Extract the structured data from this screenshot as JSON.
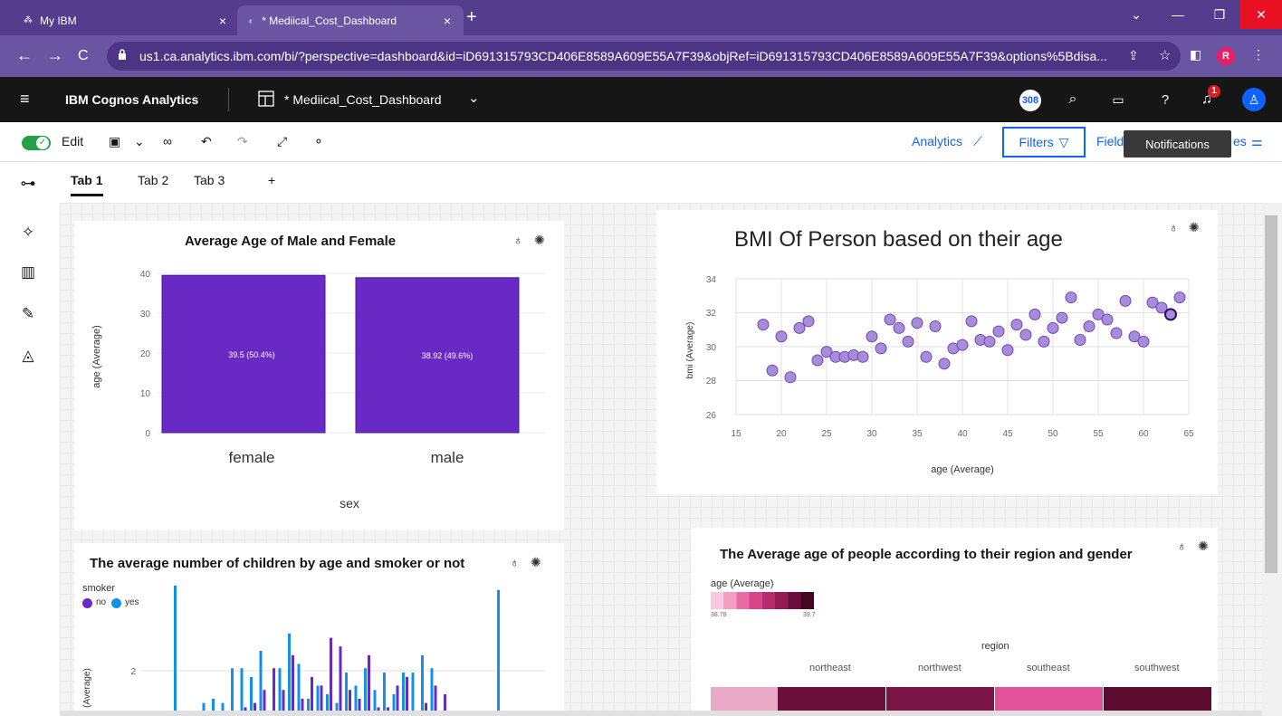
{
  "browser": {
    "tabs": [
      {
        "title": "My IBM",
        "close": "×"
      },
      {
        "title": "* Mediical_Cost_Dashboard",
        "close": "×"
      }
    ],
    "new_tab": "+",
    "url": "us1.ca.analytics.ibm.com/bi/?perspective=dashboard&id=iD691315793CD406E8589A609E55A7F39&objRef=iD691315793CD406E8589A609E55A7F39&options%5Bdisa...",
    "profile": "R"
  },
  "app": {
    "menu": "≡",
    "brand": "IBM Cognos Analytics",
    "dashboard_name": "* Mediical_Cost_Dashboard",
    "badge_count": "308",
    "notif_count": "1"
  },
  "toolbar": {
    "edit": "Edit",
    "analytics": "Analytics",
    "filters": "Filters",
    "fields": "Field",
    "properties": "es",
    "tooltip": "Notifications"
  },
  "tabs": {
    "tab1": "Tab 1",
    "tab2": "Tab 2",
    "tab3": "Tab 3",
    "add": "+"
  },
  "charts": {
    "bar": {
      "title": "Average Age of Male and Female",
      "ylabel": "age (Average)",
      "xlabel": "sex",
      "yticks": [
        "40",
        "30",
        "20",
        "10",
        "0"
      ],
      "categories": [
        "female",
        "male"
      ],
      "labels": [
        "39.5 (50.4%)",
        "38.92 (49.6%)"
      ]
    },
    "scatter": {
      "title": "BMI Of Person based on their age",
      "ylabel": "bmi (Average)",
      "xlabel": "age (Average)",
      "yticks": [
        "34",
        "32",
        "30",
        "28",
        "26"
      ],
      "xticks": [
        "15",
        "20",
        "25",
        "30",
        "35",
        "40",
        "45",
        "50",
        "55",
        "60",
        "65"
      ]
    },
    "children": {
      "title": "The average number of children by age and smoker or not",
      "legend_title": "smoker",
      "legend": [
        "no",
        "yes"
      ],
      "ylabel": "(Average)",
      "ytick": "2"
    },
    "heat": {
      "title": "The Average age of people according to their region and gender",
      "legend_title": "age (Average)",
      "legend_min": "38.78",
      "legend_max": "39.7",
      "col_title": "region",
      "columns": [
        "northeast",
        "northwest",
        "southeast",
        "southwest"
      ]
    }
  },
  "chart_data": [
    {
      "type": "bar",
      "title": "Average Age of Male and Female",
      "xlabel": "sex",
      "ylabel": "age (Average)",
      "categories": [
        "female",
        "male"
      ],
      "values": [
        39.5,
        38.92
      ],
      "ylim": [
        0,
        40
      ],
      "color": "#6929c4"
    },
    {
      "type": "scatter",
      "title": "BMI Of Person based on their age",
      "xlabel": "age (Average)",
      "ylabel": "bmi (Average)",
      "xlim": [
        15,
        65
      ],
      "ylim": [
        26,
        34
      ],
      "color": "#a98bdc",
      "points": [
        [
          18,
          31.3
        ],
        [
          19,
          28.6
        ],
        [
          20,
          30.6
        ],
        [
          21,
          28.2
        ],
        [
          22,
          31.1
        ],
        [
          23,
          31.5
        ],
        [
          24,
          29.2
        ],
        [
          25,
          29.7
        ],
        [
          26,
          29.4
        ],
        [
          27,
          29.4
        ],
        [
          28,
          29.5
        ],
        [
          29,
          29.4
        ],
        [
          30,
          30.6
        ],
        [
          31,
          29.9
        ],
        [
          32,
          31.6
        ],
        [
          33,
          31.1
        ],
        [
          34,
          30.3
        ],
        [
          35,
          31.4
        ],
        [
          36,
          29.4
        ],
        [
          37,
          31.2
        ],
        [
          38,
          29.0
        ],
        [
          39,
          29.9
        ],
        [
          40,
          30.1
        ],
        [
          41,
          31.5
        ],
        [
          42,
          30.4
        ],
        [
          43,
          30.3
        ],
        [
          44,
          30.9
        ],
        [
          45,
          29.8
        ],
        [
          46,
          31.3
        ],
        [
          47,
          30.7
        ],
        [
          48,
          31.9
        ],
        [
          49,
          30.3
        ],
        [
          50,
          31.1
        ],
        [
          51,
          31.7
        ],
        [
          52,
          32.9
        ],
        [
          53,
          30.4
        ],
        [
          54,
          31.2
        ],
        [
          55,
          31.9
        ],
        [
          56,
          31.6
        ],
        [
          57,
          30.8
        ],
        [
          58,
          32.7
        ],
        [
          59,
          30.6
        ],
        [
          60,
          30.3
        ],
        [
          61,
          32.6
        ],
        [
          62,
          32.3
        ],
        [
          63,
          31.9
        ],
        [
          64,
          32.9
        ]
      ]
    },
    {
      "type": "bar",
      "title": "The average number of children by age and smoker or not",
      "ylabel": "(Average)",
      "series": [
        {
          "name": "no",
          "color": "#6929c4",
          "values": [
            0,
            0,
            0,
            0,
            0,
            0.05,
            0.1,
            0.2,
            0.3,
            0.6,
            1.1,
            0.6,
            1.4,
            0.4,
            0.9,
            0.7,
            1.8,
            1.6,
            0.6,
            0.4,
            1.4,
            0.2,
            0.2,
            0.7,
            0.9,
            0.1,
            0.3,
            0.7,
            0.5,
            0,
            0,
            0,
            0,
            0,
            0,
            0,
            0,
            0
          ]
        },
        {
          "name": "yes",
          "color": "#1192e8",
          "values": [
            3.0,
            0,
            0.1,
            0.3,
            0.4,
            0.3,
            1.1,
            1.1,
            0.9,
            1.5,
            0.1,
            1.1,
            1.9,
            1.2,
            0.4,
            0.7,
            0.5,
            0.3,
            1.0,
            0.7,
            1.1,
            0.6,
            1.0,
            0.5,
            1.0,
            1.0,
            1.4,
            1.1,
            0,
            0,
            0,
            0,
            0,
            0,
            2.9,
            0,
            0,
            0
          ]
        }
      ],
      "ylim": [
        0,
        3.5
      ]
    },
    {
      "type": "heatmap",
      "title": "The Average age of people according to their region and gender",
      "columns": [
        "northeast",
        "northwest",
        "southeast",
        "southwest"
      ],
      "column_title": "region",
      "legend_range": [
        38.78,
        39.7
      ],
      "colors": [
        "#6b0f3a",
        "#7a1545",
        "#e2519a",
        "#5c0a2e"
      ]
    }
  ]
}
